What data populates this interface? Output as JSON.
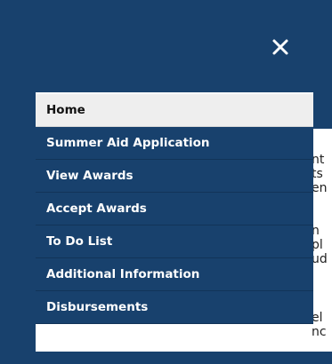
{
  "colors": {
    "brand_navy": "#18416d",
    "active_item_bg": "#eeeeee",
    "menu_text": "#ffffff"
  },
  "header": {
    "close_icon": "close-icon"
  },
  "menu": {
    "items": [
      {
        "label": "Home",
        "active": true
      },
      {
        "label": "Summer Aid Application",
        "active": false
      },
      {
        "label": "View Awards",
        "active": false
      },
      {
        "label": "Accept Awards",
        "active": false
      },
      {
        "label": "To Do List",
        "active": false
      },
      {
        "label": "Additional Information",
        "active": false
      },
      {
        "label": "Disbursements",
        "active": false
      }
    ]
  },
  "background_text": {
    "fragments": [
      "nt",
      "ts",
      "en",
      "n",
      "pl",
      "ud",
      "el",
      "nc"
    ]
  }
}
